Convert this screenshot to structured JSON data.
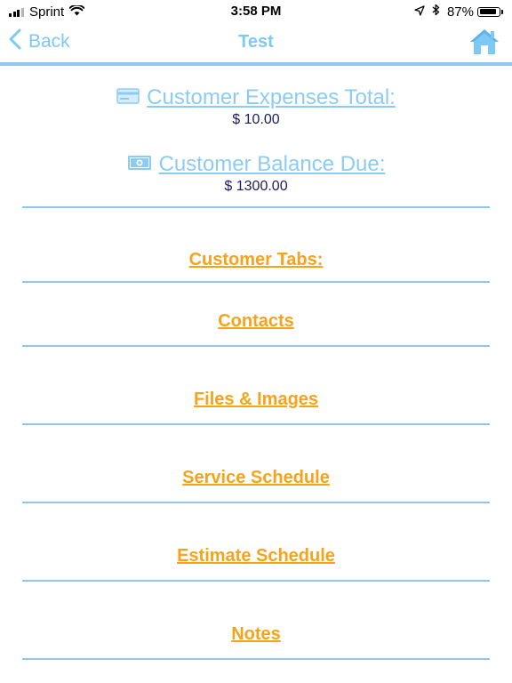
{
  "status_bar": {
    "carrier": "Sprint",
    "time": "3:58 PM",
    "battery_percent": "87%",
    "battery_level": 0.87,
    "signal_bars_filled": 3,
    "signal_bars_total": 4
  },
  "nav": {
    "back_label": "Back",
    "title": "Test",
    "home_icon": "home-icon"
  },
  "totals": {
    "expenses": {
      "icon": "credit-card-icon",
      "label": "Customer Expenses Total:",
      "value": "$ 10.00"
    },
    "balance": {
      "icon": "cash-icon",
      "label": "Customer Balance Due:",
      "value": "$ 1300.00"
    }
  },
  "tabs": {
    "heading": "Customer Tabs:",
    "items": [
      {
        "label": "Contacts"
      },
      {
        "label": "Files & Images"
      },
      {
        "label": "Service Schedule"
      },
      {
        "label": "Estimate Schedule"
      },
      {
        "label": "Notes"
      }
    ]
  },
  "colors": {
    "accent_blue": "#7ec8f5",
    "link_orange": "#f7a21b",
    "value_navy": "#1b1b60",
    "divider": "#8cc8ef"
  }
}
